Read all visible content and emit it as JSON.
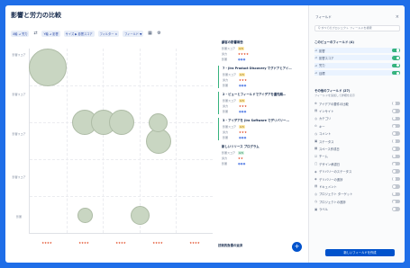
{
  "page": {
    "title": "影響と労力の比較"
  },
  "toolbar": {
    "chips": [
      "X軸 ⊿ 労力",
      "Y軸 ⊿ 影響",
      "サイズ ▶ 影響スコア",
      "フィルター ×",
      "フィールド ▼"
    ]
  },
  "chart": {
    "y_labels": [
      "影響スコア",
      "影響スコア",
      "影響スコア",
      "影響スコア",
      "影響"
    ],
    "x_labels": [
      "★★★★",
      "★★★★",
      "★★★★",
      "★★★★",
      "★★★★"
    ]
  },
  "chart_data": {
    "type": "scatter",
    "x": [
      0.5,
      1.5,
      2.0,
      2.5,
      3.5,
      3.5,
      1.5,
      3.0
    ],
    "y": [
      4.5,
      3.0,
      3.0,
      3.0,
      2.5,
      3.0,
      0.5,
      0.5
    ],
    "size": [
      3,
      2,
      2,
      2,
      2,
      1.5,
      1.2,
      1.5
    ]
  },
  "cards": [
    {
      "title": "顧客の影響報告",
      "impact_label": "影響スコア",
      "impact": "4.5",
      "effort_label": "労力",
      "effort": "★★★★",
      "field_label": "影響",
      "field": "●●●"
    },
    {
      "title": "7 - Jira Product Discovery マグドアとアイ…",
      "impact_label": "影響スコア",
      "impact": "4.5",
      "effort_label": "労力",
      "effort": "★★★",
      "field_label": "影響",
      "field": "●●●"
    },
    {
      "title": "2 - ビューとフィールドでアイデアを優先順…",
      "impact_label": "影響スコア",
      "impact": "4.5",
      "effort_label": "労力",
      "effort": "★★★",
      "field_label": "影響",
      "field": "●●●"
    },
    {
      "title": "3 - アイデアを Jira Software でデリバリー…",
      "impact_label": "影響スコア",
      "impact": "4.5",
      "effort_label": "労力",
      "effort": "★★★",
      "field_label": "影響",
      "field": "●●●"
    },
    {
      "title": "新しいリリース プログラム",
      "impact_label": "影響スコア",
      "impact": "4.5",
      "effort_label": "労力",
      "effort": "★★",
      "field_label": "影響",
      "field": "●●●"
    }
  ],
  "cards_bottom": "技術的負債の返済",
  "panel": {
    "header": "フィールド",
    "search_placeholder": "Q すべてのプロジェクト フィールドを検索",
    "section1_title": "このビューのフィールド (4)",
    "section1_items": [
      {
        "icon": "⊿",
        "label": "影響",
        "on": true
      },
      {
        "icon": "⊿",
        "label": "影響スコア",
        "on": true
      },
      {
        "icon": "⊿",
        "label": "労力",
        "on": true
      },
      {
        "icon": "⊿",
        "label": "目標",
        "on": true
      }
    ],
    "section2_title": "その他のフィールド (27)",
    "section2_sub": "フィールドを追加して詳細を表示",
    "section2_items": [
      {
        "icon": "⊕",
        "label": "アイデアの要件の比較",
        "on": false
      },
      {
        "icon": "▤",
        "label": "インサイト",
        "on": false
      },
      {
        "icon": "◎",
        "label": "カテゴリ",
        "on": false
      },
      {
        "icon": "⊙",
        "label": "キー",
        "on": false
      },
      {
        "icon": "◷",
        "label": "コメント",
        "on": false
      },
      {
        "icon": "▣",
        "label": "ステータス",
        "on": false
      },
      {
        "icon": "▦",
        "label": "スペース作成日",
        "on": false
      },
      {
        "icon": "☑",
        "label": "チーム",
        "on": false
      },
      {
        "icon": "▢",
        "label": "デザイン承認日",
        "on": false
      },
      {
        "icon": "◈",
        "label": "デリバリーのステータス",
        "on": false
      },
      {
        "icon": "◈",
        "label": "デリバリーの進捗",
        "on": false
      },
      {
        "icon": "▤",
        "label": "ドキュメント",
        "on": false
      },
      {
        "icon": "◎",
        "label": "プロジェクト ターゲット",
        "on": false
      },
      {
        "icon": "◷",
        "label": "プロジェクトの進捗",
        "on": false
      },
      {
        "icon": "▣",
        "label": "ラベル",
        "on": false
      }
    ],
    "create_button": "新しいフィールドを作成"
  }
}
